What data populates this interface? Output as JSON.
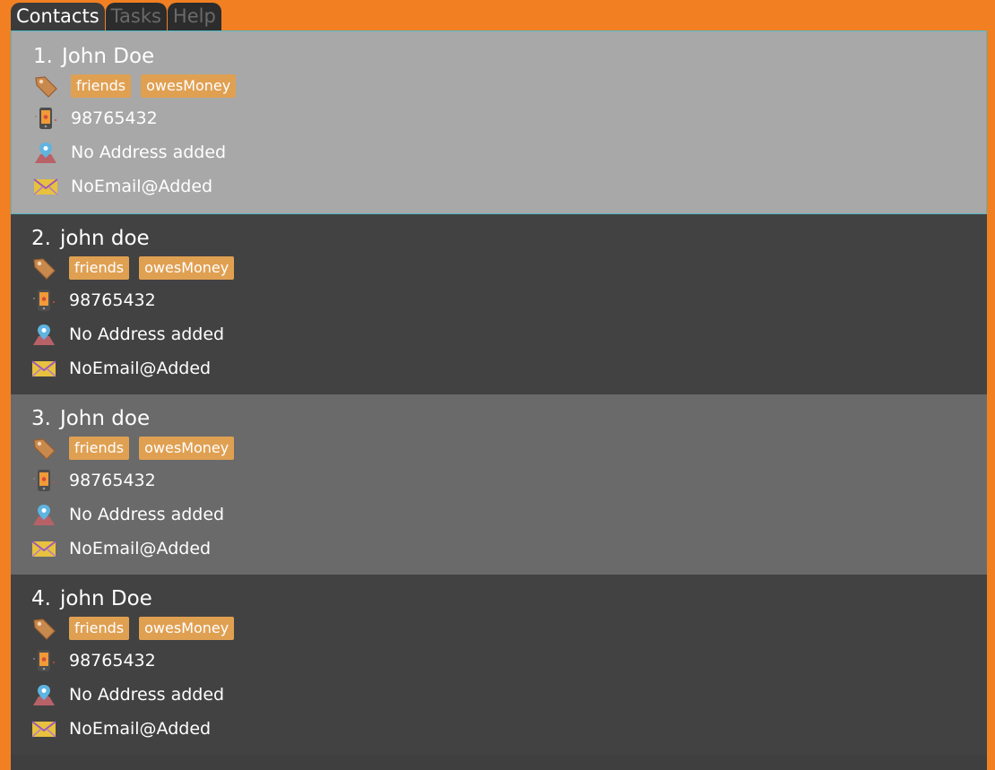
{
  "tabs": [
    {
      "label": "Contacts",
      "active": true
    },
    {
      "label": "Tasks",
      "active": false
    },
    {
      "label": "Help",
      "active": false
    }
  ],
  "contacts": [
    {
      "index": "1.",
      "name": "John Doe",
      "tags": [
        "friends",
        "owesMoney"
      ],
      "phone": "98765432",
      "address": "No Address added",
      "email": "NoEmail@Added",
      "selected": true
    },
    {
      "index": "2.",
      "name": "john doe",
      "tags": [
        "friends",
        "owesMoney"
      ],
      "phone": "98765432",
      "address": "No Address added",
      "email": "NoEmail@Added",
      "selected": false
    },
    {
      "index": "3.",
      "name": "John doe",
      "tags": [
        "friends",
        "owesMoney"
      ],
      "phone": "98765432",
      "address": "No Address added",
      "email": "NoEmail@Added",
      "selected": false
    },
    {
      "index": "4.",
      "name": "john Doe",
      "tags": [
        "friends",
        "owesMoney"
      ],
      "phone": "98765432",
      "address": "No Address added",
      "email": "NoEmail@Added",
      "selected": false
    }
  ],
  "icons": {
    "tag": "tag-icon",
    "phone": "phone-icon",
    "address": "location-pin-icon",
    "email": "envelope-icon"
  },
  "colors": {
    "window_background": "#f28023",
    "selected_card": "#a8a8a8",
    "dark_card": "#424242",
    "light_card": "#6a6a6a",
    "tag_background": "#e0a052",
    "selected_border": "#52b8c6"
  }
}
